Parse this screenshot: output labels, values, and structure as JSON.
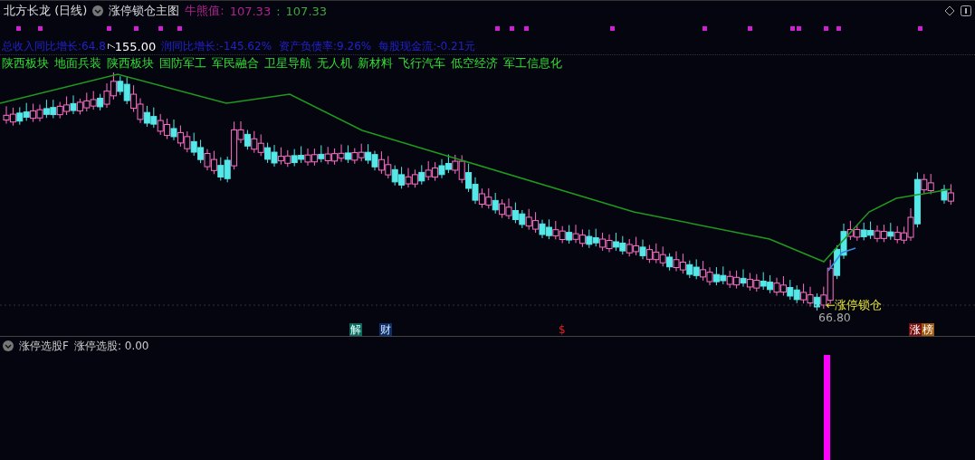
{
  "header": {
    "stock": "北方长龙 (日线)",
    "indicator": "涨停锁仓主图",
    "value_label": "牛熊值:",
    "value_1": "107.33",
    "separator": ":",
    "value_2": "107.33"
  },
  "fundamentals": [
    "总收入同比增长:64.8",
    "润同比增长:-145.62%",
    "资产负债率:9.26%",
    "每股现金流:-0.21元"
  ],
  "sectors": [
    "陕西板块",
    "地面兵装",
    "陕西板块",
    "国防军工",
    "军民融合",
    "卫星导航",
    "无人机",
    "新材料",
    "飞行汽车",
    "低空经济",
    "军工信息化"
  ],
  "main_chart": {
    "high_label": "155.00",
    "low_label": "66.80",
    "signal_label": "←涨停锁仓",
    "events": [
      {
        "text": "解",
        "kind": "unlock"
      },
      {
        "text": "财",
        "kind": "finance"
      },
      {
        "text": "$",
        "kind": "dollar"
      },
      {
        "text": "涨",
        "kind": "limit-up"
      },
      {
        "text": "榜",
        "kind": "list"
      }
    ]
  },
  "sub_panel": {
    "title": "涨停选股F",
    "reading": "涨停选股: 0.00"
  }
}
